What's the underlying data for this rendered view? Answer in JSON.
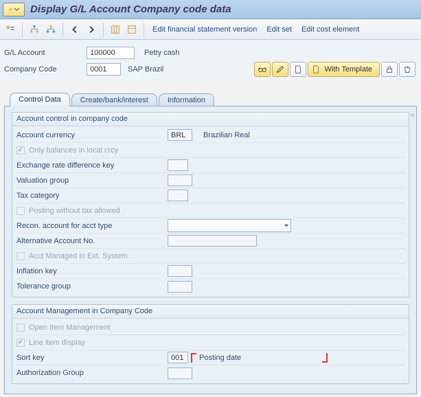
{
  "title": "Display G/L Account Company code data",
  "toolbar": {
    "t1": "Edit financial statement version",
    "t2": "Edit set",
    "t3": "Edit cost element"
  },
  "header": {
    "gl_label": "G/L Account",
    "gl_value": "100000",
    "gl_desc": "Petty cash",
    "cc_label": "Company Code",
    "cc_value": "0001",
    "cc_desc": "SAP Brazil",
    "with_template": "With Template"
  },
  "tabs": {
    "t1": "Control Data",
    "t2": "Create/bank/interest",
    "t3": "Information"
  },
  "group1": {
    "title": "Account control in company code",
    "currency_label": "Account currency",
    "currency_value": "BRL",
    "currency_desc": "Brazilian Real",
    "only_balances": "Only balances in local crcy",
    "ex_rate": "Exchange rate difference key",
    "val_group": "Valuation group",
    "tax_cat": "Tax category",
    "posting_wo_tax": "Posting without tax allowed",
    "recon": "Recon. account for acct type",
    "alt_acct": "Alternative Account No.",
    "ext_sys": "Acct Managed in Ext. System",
    "infl_key": "Inflation key",
    "tol_group": "Tolerance group"
  },
  "group2": {
    "title": "Account Management in Company Code",
    "open_item": "Open Item Management",
    "line_item": "Line item display",
    "sort_label": "Sort key",
    "sort_value": "001",
    "sort_desc": "Posting date",
    "auth_group": "Authorization Group"
  }
}
